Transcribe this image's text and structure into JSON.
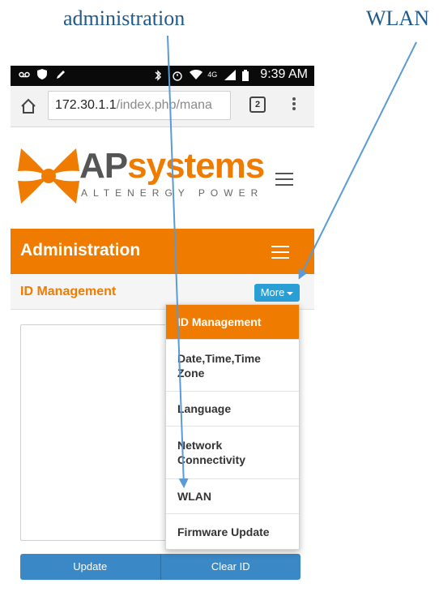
{
  "annotations": {
    "admin_label": "administration",
    "wlan_label": "WLAN"
  },
  "status_bar": {
    "time": "9:39 AM",
    "network": "4G"
  },
  "browser": {
    "url_host": "172.30.1.1",
    "url_path": "/index.php/mana",
    "tab_count": "2"
  },
  "site": {
    "brand_ap": "AP",
    "brand_systems": "systems",
    "tagline": "ALTENERGY POWER"
  },
  "admin_bar": {
    "title": "Administration"
  },
  "section": {
    "title": "ID Management",
    "more_label": "More"
  },
  "dropdown": {
    "items": [
      "ID Management",
      "Date,Time,Time Zone",
      "Language",
      "Network Connectivity",
      "WLAN",
      "Firmware Update"
    ]
  },
  "buttons": {
    "update": "Update",
    "clear": "Clear ID"
  },
  "colors": {
    "brand_orange": "#ef7c00",
    "link_blue": "#2a9fd6",
    "button_blue": "#3b88c6",
    "annotation_blue": "#1f5a8a"
  }
}
